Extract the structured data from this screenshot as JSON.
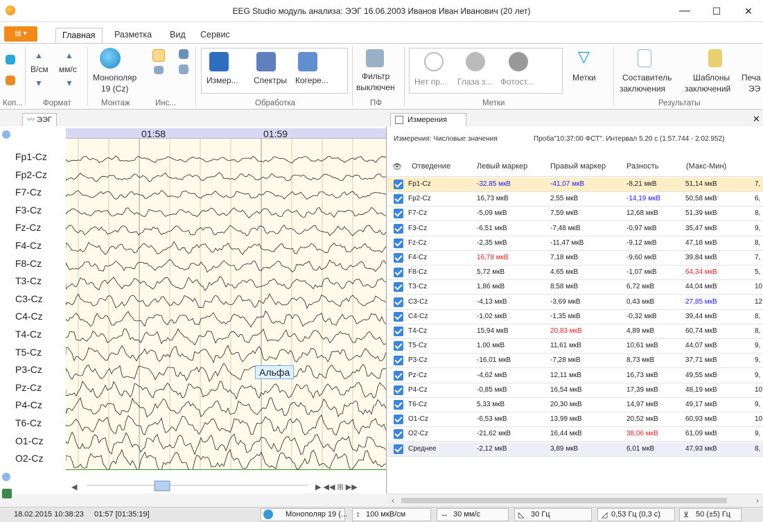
{
  "window": {
    "title": "EEG Studio модуль анализа: ЭЭГ 16.06.2003 Иванов Иван Иванович (20 лет)",
    "minimize": "—",
    "maximize": "☐",
    "close": "✕"
  },
  "ribbon_tabs": [
    {
      "label": "Главная",
      "active": true
    },
    {
      "label": "Разметка",
      "active": false
    },
    {
      "label": "Вид",
      "active": false
    },
    {
      "label": "Сервис",
      "active": false
    }
  ],
  "ribbon": {
    "scale_up": "В/см",
    "speed": "мм/с",
    "montage": "Монополяр",
    "montage_sub": "19 (Cz)",
    "measure": "Измер...",
    "spectra": "Спектры",
    "coherence": "Когере...",
    "filter": "Фильтр",
    "filter_sub": "выключен",
    "mark1": "Нет пр...",
    "mark2": "Глаза з...",
    "mark3": "Фотост...",
    "marks": "Метки",
    "compose": "Составитель",
    "compose_sub": "заключения",
    "templates": "Шаблоны",
    "templates_sub": "заключений",
    "print": "Печа",
    "print_sub": "ЭЭ",
    "groups": [
      "Коп...",
      "Формат",
      "Монтаж",
      "Инс...",
      "Обработка",
      "ПФ",
      "Метки",
      "Результаты"
    ]
  },
  "eeg": {
    "tab_label": "ЭЭГ",
    "time_labels": [
      "01:58",
      "01:59"
    ],
    "channels": [
      "Fp1-Cz",
      "Fp2-Cz",
      "F7-Cz",
      "F3-Cz",
      "Fz-Cz",
      "F4-Cz",
      "F8-Cz",
      "T3-Cz",
      "C3-Cz",
      "C4-Cz",
      "T4-Cz",
      "T5-Cz",
      "P3-Cz",
      "Pz-Cz",
      "P4-Cz",
      "T6-Cz",
      "O1-Cz",
      "O2-Cz"
    ],
    "marker_tag": "Альфа"
  },
  "measurements": {
    "tab_label": "Измерения",
    "mode": "Измерения: Числовые значения",
    "probe": "Проба\"10:37:00 ФСТ\". Интервал 5.20 с (1:57.744 - 2:02.952)",
    "columns": [
      "Отведение",
      "Левый маркер",
      "Правый маркер",
      "Разность",
      "(Макс-Мин)"
    ],
    "rows": [
      {
        "lead": "Fp1-Cz",
        "left": "-32,85 мкВ",
        "right": "-41,07 мкВ",
        "diff": "-8,21 мкВ",
        "range": "51,14 мкВ",
        "extra": "7,"
      },
      {
        "lead": "Fp2-Cz",
        "left": "16,73 мкВ",
        "right": "2,55 мкВ",
        "diff": "-14,19 мкВ",
        "range": "50,58 мкВ",
        "extra": "6,"
      },
      {
        "lead": "F7-Cz",
        "left": "-5,09 мкВ",
        "right": "7,59 мкВ",
        "diff": "12,68 мкВ",
        "range": "51,39 мкВ",
        "extra": "8,"
      },
      {
        "lead": "F3-Cz",
        "left": "-6,51 мкВ",
        "right": "-7,48 мкВ",
        "diff": "-0,97 мкВ",
        "range": "35,47 мкВ",
        "extra": "9,"
      },
      {
        "lead": "Fz-Cz",
        "left": "-2,35 мкВ",
        "right": "-11,47 мкВ",
        "diff": "-9,12 мкВ",
        "range": "47,18 мкВ",
        "extra": "8,"
      },
      {
        "lead": "F4-Cz",
        "left": "16,78 мкВ",
        "right": "7,18 мкВ",
        "diff": "-9,60 мкВ",
        "range": "39,84 мкВ",
        "extra": "7,"
      },
      {
        "lead": "F8-Cz",
        "left": "5,72 мкВ",
        "right": "4,65 мкВ",
        "diff": "-1,07 мкВ",
        "range": "64,34 мкВ",
        "extra": "5,"
      },
      {
        "lead": "T3-Cz",
        "left": "1,86 мкВ",
        "right": "8,58 мкВ",
        "diff": "6,72 мкВ",
        "range": "44,04 мкВ",
        "extra": "10"
      },
      {
        "lead": "C3-Cz",
        "left": "-4,13 мкВ",
        "right": "-3,69 мкВ",
        "diff": "0,43 мкВ",
        "range": "27,85 мкВ",
        "extra": "12"
      },
      {
        "lead": "C4-Cz",
        "left": "-1,02 мкВ",
        "right": "-1,35 мкВ",
        "diff": "-0,32 мкВ",
        "range": "39,44 мкВ",
        "extra": "8,"
      },
      {
        "lead": "T4-Cz",
        "left": "15,94 мкВ",
        "right": "20,83 мкВ",
        "diff": "4,89 мкВ",
        "range": "60,74 мкВ",
        "extra": "8,"
      },
      {
        "lead": "T5-Cz",
        "left": "1,00 мкВ",
        "right": "11,61 мкВ",
        "diff": "10,61 мкВ",
        "range": "44,07 мкВ",
        "extra": "9,"
      },
      {
        "lead": "P3-Cz",
        "left": "-16,01 мкВ",
        "right": "-7,28 мкВ",
        "diff": "8,73 мкВ",
        "range": "37,71 мкВ",
        "extra": "9,"
      },
      {
        "lead": "Pz-Cz",
        "left": "-4,62 мкВ",
        "right": "12,11 мкВ",
        "diff": "16,73 мкВ",
        "range": "49,55 мкВ",
        "extra": "9,"
      },
      {
        "lead": "P4-Cz",
        "left": "-0,85 мкВ",
        "right": "16,54 мкВ",
        "diff": "17,39 мкВ",
        "range": "48,19 мкВ",
        "extra": "10"
      },
      {
        "lead": "T6-Cz",
        "left": "5,33 мкВ",
        "right": "20,30 мкВ",
        "diff": "14,97 мкВ",
        "range": "49,17 мкВ",
        "extra": "9,"
      },
      {
        "lead": "O1-Cz",
        "left": "-6,53 мкВ",
        "right": "13,99 мкВ",
        "diff": "20,52 мкВ",
        "range": "60,93 мкВ",
        "extra": "10"
      },
      {
        "lead": "O2-Cz",
        "left": "-21,62 мкВ",
        "right": "16,44 мкВ",
        "diff": "38,06 мкВ",
        "range": "61,09 мкВ",
        "extra": "9,"
      }
    ],
    "average": {
      "lead": "Среднее",
      "left": "-2,12 мкВ",
      "right": "3,89 мкВ",
      "diff": "6,01 мкВ",
      "range": "47,93 мкВ",
      "extra": "8,"
    }
  },
  "colors": {
    "min": "#1a1aff",
    "max": "#e02020",
    "accent": "#f08a18"
  },
  "status": {
    "datetime": "18.02.2015 10:38:23",
    "position": "01:57 [01:35:19]",
    "montage": "Монополяр 19 (...",
    "sensitivity": "100 мкВ/см",
    "speed": "30 мм/с",
    "lowpass": "30 Гц",
    "highpass": "0,53 Гц (0,3 с)",
    "notch": "50 (±5) Гц"
  }
}
